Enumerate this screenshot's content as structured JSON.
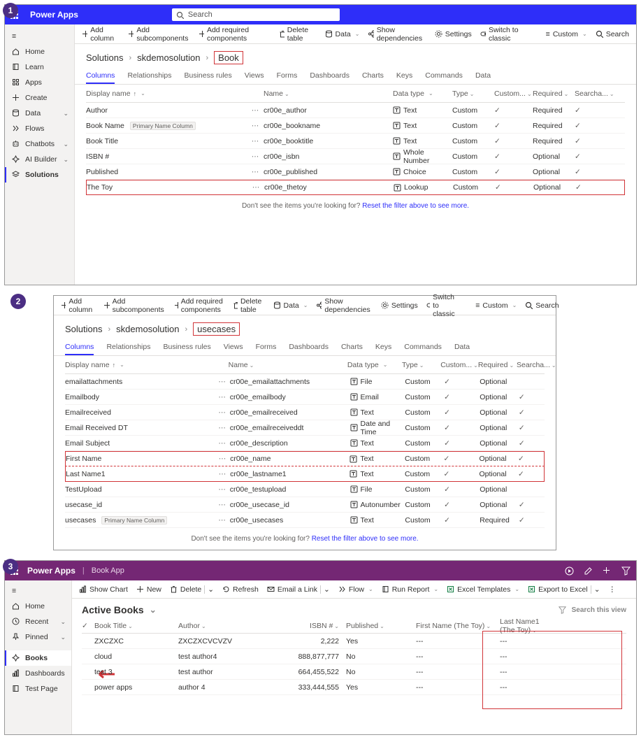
{
  "header": {
    "brand": "Power Apps",
    "search_placeholder": "Search"
  },
  "sidebar1": {
    "items": [
      "Home",
      "Learn",
      "Apps",
      "Create",
      "Data",
      "Flows",
      "Chatbots",
      "AI Builder",
      "Solutions"
    ]
  },
  "cmdbar1": {
    "add_column": "Add column",
    "add_subcomponents": "Add subcomponents",
    "add_required": "Add required components",
    "delete_table": "Delete table",
    "data": "Data",
    "show_dep": "Show dependencies",
    "settings": "Settings",
    "switch_classic": "Switch to classic",
    "custom": "Custom",
    "search": "Search"
  },
  "crumbs1": {
    "a": "Solutions",
    "b": "skdemosolution",
    "c": "Book"
  },
  "tabs": [
    "Columns",
    "Relationships",
    "Business rules",
    "Views",
    "Forms",
    "Dashboards",
    "Charts",
    "Keys",
    "Commands",
    "Data"
  ],
  "gridhead": {
    "display": "Display name",
    "name": "Name",
    "datatype": "Data type",
    "type": "Type",
    "custom": "Custom...",
    "required": "Required",
    "search": "Searcha..."
  },
  "rows1": [
    {
      "disp": "Author",
      "name": "cr00e_author",
      "dtype": "Text",
      "type": "Custom",
      "cust": "✓",
      "req": "Required",
      "sea": "✓"
    },
    {
      "disp": "Book Name",
      "pill": "Primary Name Column",
      "name": "cr00e_bookname",
      "dtype": "Text",
      "type": "Custom",
      "cust": "✓",
      "req": "Required",
      "sea": "✓"
    },
    {
      "disp": "Book Title",
      "name": "cr00e_booktitle",
      "dtype": "Text",
      "type": "Custom",
      "cust": "✓",
      "req": "Required",
      "sea": "✓"
    },
    {
      "disp": "ISBN #",
      "name": "cr00e_isbn",
      "dtype": "Whole Number",
      "type": "Custom",
      "cust": "✓",
      "req": "Optional",
      "sea": "✓"
    },
    {
      "disp": "Published",
      "name": "cr00e_published",
      "dtype": "Choice",
      "type": "Custom",
      "cust": "✓",
      "req": "Optional",
      "sea": "✓"
    },
    {
      "disp": "The Toy",
      "name": "cr00e_thetoy",
      "dtype": "Lookup",
      "type": "Custom",
      "cust": "✓",
      "req": "Optional",
      "sea": "✓",
      "hl": true
    }
  ],
  "nosee": {
    "txt": "Don't see the items you're looking for? ",
    "link": "Reset the filter above to see more."
  },
  "crumbs2": {
    "a": "Solutions",
    "b": "skdemosolution",
    "c": "usecases"
  },
  "rows2": [
    {
      "disp": "emailattachments",
      "name": "cr00e_emailattachments",
      "dtype": "File",
      "type": "Custom",
      "cust": "✓",
      "req": "Optional",
      "sea": ""
    },
    {
      "disp": "Emailbody",
      "name": "cr00e_emailbody",
      "dtype": "Email",
      "type": "Custom",
      "cust": "✓",
      "req": "Optional",
      "sea": "✓"
    },
    {
      "disp": "Emailreceived",
      "name": "cr00e_emailreceived",
      "dtype": "Text",
      "type": "Custom",
      "cust": "✓",
      "req": "Optional",
      "sea": "✓"
    },
    {
      "disp": "Email Received DT",
      "name": "cr00e_emailreceiveddt",
      "dtype": "Date and Time",
      "type": "Custom",
      "cust": "✓",
      "req": "Optional",
      "sea": "✓"
    },
    {
      "disp": "Email Subject",
      "name": "cr00e_description",
      "dtype": "Text",
      "type": "Custom",
      "cust": "✓",
      "req": "Optional",
      "sea": "✓"
    },
    {
      "disp": "First Name",
      "name": "cr00e_name",
      "dtype": "Text",
      "type": "Custom",
      "cust": "✓",
      "req": "Optional",
      "sea": "✓",
      "hltop": true
    },
    {
      "disp": "Last Name1",
      "name": "cr00e_lastname1",
      "dtype": "Text",
      "type": "Custom",
      "cust": "✓",
      "req": "Optional",
      "sea": "✓",
      "hlbot": true
    },
    {
      "disp": "TestUpload",
      "name": "cr00e_testupload",
      "dtype": "File",
      "type": "Custom",
      "cust": "✓",
      "req": "Optional",
      "sea": ""
    },
    {
      "disp": "usecase_id",
      "name": "cr00e_usecase_id",
      "dtype": "Autonumber",
      "type": "Custom",
      "cust": "✓",
      "req": "Optional",
      "sea": "✓"
    },
    {
      "disp": "usecases",
      "pill": "Primary Name Column",
      "name": "cr00e_usecases",
      "dtype": "Text",
      "type": "Custom",
      "cust": "✓",
      "req": "Required",
      "sea": "✓"
    }
  ],
  "header3": {
    "brand": "Power Apps",
    "app": "Book App"
  },
  "sidebar3": {
    "home": "Home",
    "recent": "Recent",
    "pinned": "Pinned",
    "books": "Books",
    "dash": "Dashboards",
    "test": "Test Page"
  },
  "cmdbar3": {
    "show_chart": "Show Chart",
    "new": "New",
    "delete": "Delete",
    "refresh": "Refresh",
    "email": "Email a Link",
    "flow": "Flow",
    "run": "Run Report",
    "excel_t": "Excel Templates",
    "export": "Export to Excel"
  },
  "view3": {
    "title": "Active Books",
    "search_ph": "Search this view"
  },
  "vhead": {
    "chk": "✓",
    "title": "Book Title",
    "author": "Author",
    "isbn": "ISBN #",
    "pub": "Published",
    "fn": "First Name (The Toy)",
    "ln": "Last Name1 (The Toy)"
  },
  "vrows": [
    {
      "title": "ZXCZXC",
      "author": "ZXCZXCVCVZV",
      "isbn": "2,222",
      "pub": "Yes",
      "fn": "---",
      "ln": "---"
    },
    {
      "title": "cloud",
      "author": "test author4",
      "isbn": "888,877,777",
      "pub": "No",
      "fn": "---",
      "ln": "---"
    },
    {
      "title": "test 3",
      "author": "test author",
      "isbn": "664,455,522",
      "pub": "No",
      "fn": "---",
      "ln": "---"
    },
    {
      "title": "power apps",
      "author": "author 4",
      "isbn": "333,444,555",
      "pub": "Yes",
      "fn": "---",
      "ln": "---"
    }
  ]
}
